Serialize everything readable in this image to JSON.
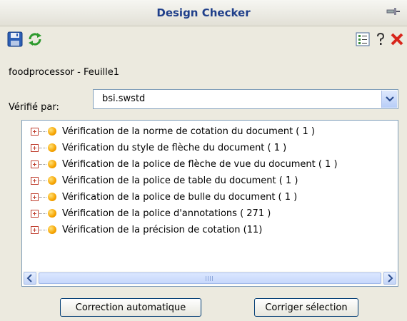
{
  "window": {
    "title": "Design Checker"
  },
  "toolbar": {
    "save_icon": "save-icon",
    "refresh_icon": "refresh-icon",
    "list_icon": "checklist-icon",
    "help_icon": "help-icon",
    "close_icon": "close-icon"
  },
  "document": {
    "path": "foodprocessor - Feuille1"
  },
  "checked_by": {
    "label": "Vérifié par:",
    "value": "bsi.swstd"
  },
  "tree": {
    "items": [
      {
        "label": "Vérification de la norme de cotation du document ( 1 )"
      },
      {
        "label": "Vérification du style de flèche du document ( 1 )"
      },
      {
        "label": "Vérification de la police de flèche de vue du document ( 1 )"
      },
      {
        "label": "Vérification de la police de table du document ( 1 )"
      },
      {
        "label": "Vérification de la police de bulle du document ( 1 )"
      },
      {
        "label": "Vérification de la police d'annotations ( 271 )"
      },
      {
        "label": "Vérification de la précision de cotation (11)"
      }
    ]
  },
  "buttons": {
    "auto_fix": "Correction automatique",
    "fix_selection": "Corriger sélection"
  },
  "colors": {
    "title": "#1f3f8a",
    "accent_orange": "#f6a400",
    "close_red": "#d8261c"
  }
}
